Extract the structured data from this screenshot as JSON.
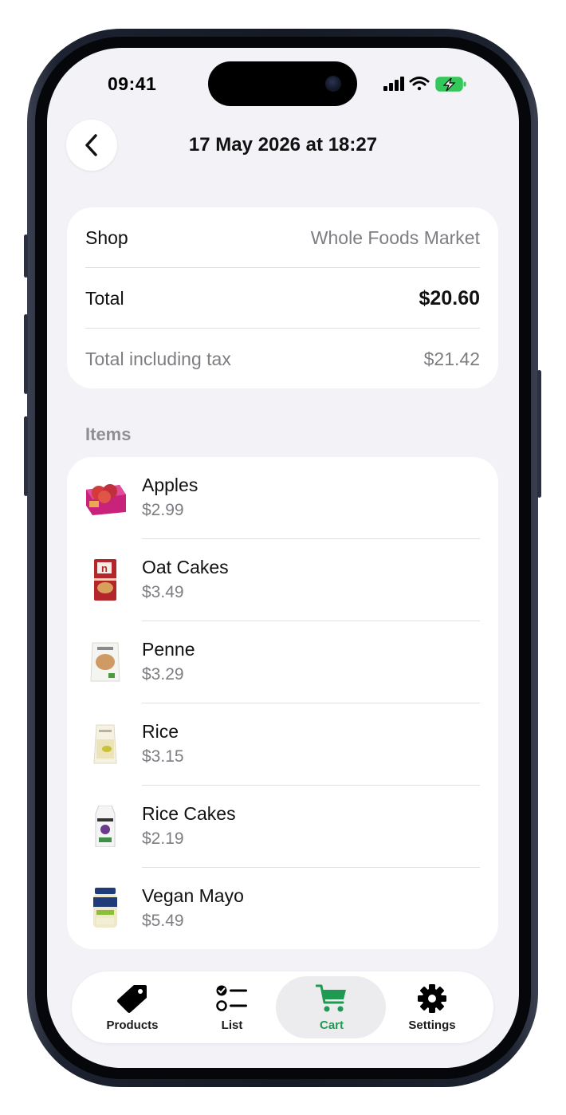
{
  "status_bar": {
    "time": "09:41"
  },
  "header": {
    "title": "17 May 2026 at 18:27"
  },
  "summary": {
    "shop_label": "Shop",
    "shop_value": "Whole Foods Market",
    "total_label": "Total",
    "total_value": "$20.60",
    "tax_label": "Total including tax",
    "tax_value": "$21.42"
  },
  "items_section": {
    "label": "Items",
    "items": [
      {
        "name": "Apples",
        "price": "$2.99",
        "icon": "apples-thumb"
      },
      {
        "name": "Oat Cakes",
        "price": "$3.49",
        "icon": "oat-cakes-thumb"
      },
      {
        "name": "Penne",
        "price": "$3.29",
        "icon": "penne-thumb"
      },
      {
        "name": "Rice",
        "price": "$3.15",
        "icon": "rice-thumb"
      },
      {
        "name": "Rice Cakes",
        "price": "$2.19",
        "icon": "rice-cakes-thumb"
      },
      {
        "name": "Vegan Mayo",
        "price": "$5.49",
        "icon": "vegan-mayo-thumb"
      }
    ]
  },
  "tabbar": {
    "tabs": [
      {
        "label": "Products",
        "icon": "tag-icon"
      },
      {
        "label": "List",
        "icon": "checklist-icon"
      },
      {
        "label": "Cart",
        "icon": "cart-icon",
        "active": true
      },
      {
        "label": "Settings",
        "icon": "gear-icon"
      }
    ]
  },
  "colors": {
    "accent": "#1f9a53",
    "battery": "#34c759",
    "background": "#f2f2f7"
  }
}
